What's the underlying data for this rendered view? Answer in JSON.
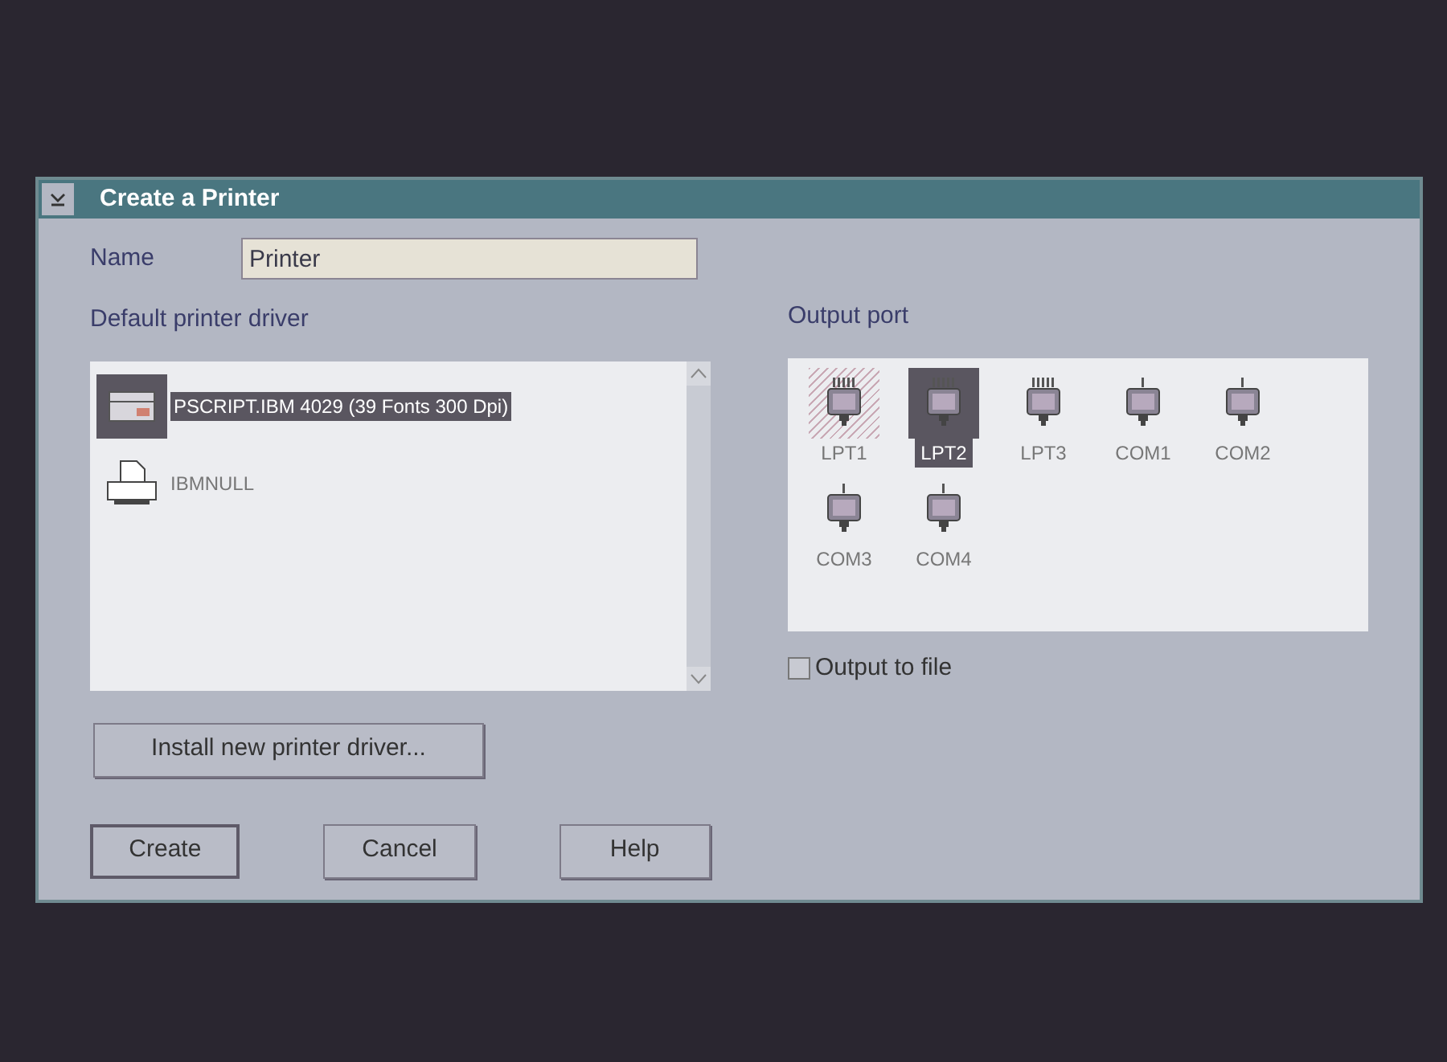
{
  "window": {
    "title": "Create a Printer"
  },
  "name_field": {
    "label": "Name",
    "value": "Printer"
  },
  "drivers": {
    "label": "Default printer driver",
    "items": [
      {
        "kind": "postscript",
        "label": "PSCRIPT.IBM 4029 (39 Fonts 300 Dpi)",
        "selected": true
      },
      {
        "kind": "null",
        "label": "IBMNULL",
        "selected": false
      }
    ]
  },
  "ports": {
    "label": "Output port",
    "items": [
      {
        "kind": "parallel",
        "label": "LPT1",
        "selected": false,
        "in_use": true
      },
      {
        "kind": "parallel",
        "label": "LPT2",
        "selected": true,
        "in_use": false
      },
      {
        "kind": "parallel",
        "label": "LPT3",
        "selected": false,
        "in_use": false
      },
      {
        "kind": "serial",
        "label": "COM1",
        "selected": false,
        "in_use": false
      },
      {
        "kind": "serial",
        "label": "COM2",
        "selected": false,
        "in_use": false
      },
      {
        "kind": "serial",
        "label": "COM3",
        "selected": false,
        "in_use": false
      },
      {
        "kind": "serial",
        "label": "COM4",
        "selected": false,
        "in_use": false
      }
    ]
  },
  "output_to_file": {
    "label": "Output to file",
    "checked": false
  },
  "install_button": {
    "label": "Install new printer driver..."
  },
  "buttons": [
    {
      "label": "Create",
      "default": true
    },
    {
      "label": "Cancel",
      "default": false
    },
    {
      "label": "Help",
      "default": false
    }
  ]
}
